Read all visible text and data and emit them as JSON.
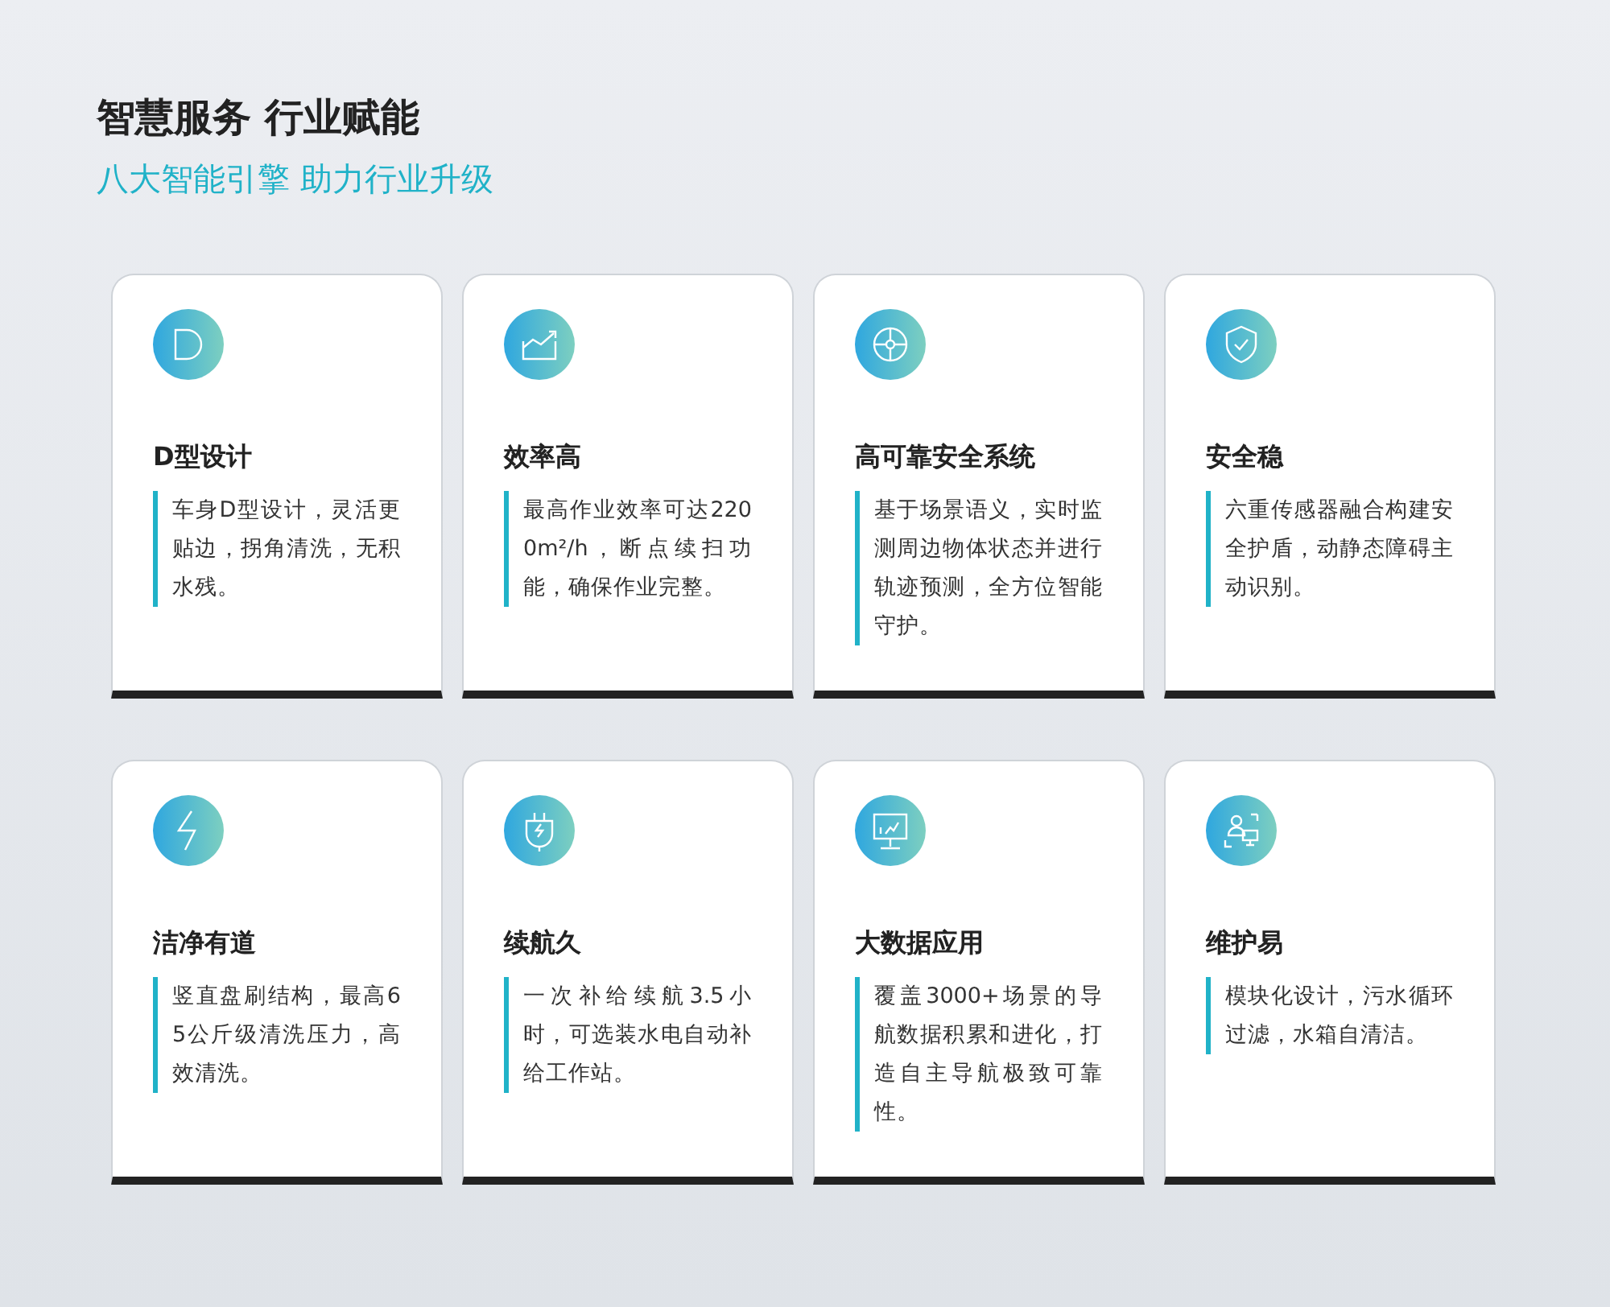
{
  "heading": {
    "title": "智慧服务 行业赋能",
    "subtitle": "八大智能引擎 助力行业升级"
  },
  "cards": [
    {
      "title": "D型设计",
      "text": "车身D型设计，灵活更贴边，拐角清洗，无积水残。"
    },
    {
      "title": "效率高",
      "text": "最高作业效率可达2200m²/h，断点续扫功能，确保作业完整。"
    },
    {
      "title": "高可靠安全系统",
      "text": "基于场景语义，实时监测周边物体状态并进行轨迹预测，全方位智能守护。"
    },
    {
      "title": "安全稳",
      "text": "六重传感器融合构建安全护盾，动静态障碍主动识别。"
    },
    {
      "title": "洁净有道",
      "text": "竖直盘刷结构，最高65公斤级清洗压力，高效清洗。"
    },
    {
      "title": "续航久",
      "text": "一次补给续航3.5小时，可选装水电自动补给工作站。"
    },
    {
      "title": "大数据应用",
      "text": "覆盖3000+场景的导航数据积累和进化，打造自主导航极致可靠性。"
    },
    {
      "title": "维护易",
      "text": "模块化设计，污水循环过滤，水箱自清洁。"
    }
  ]
}
